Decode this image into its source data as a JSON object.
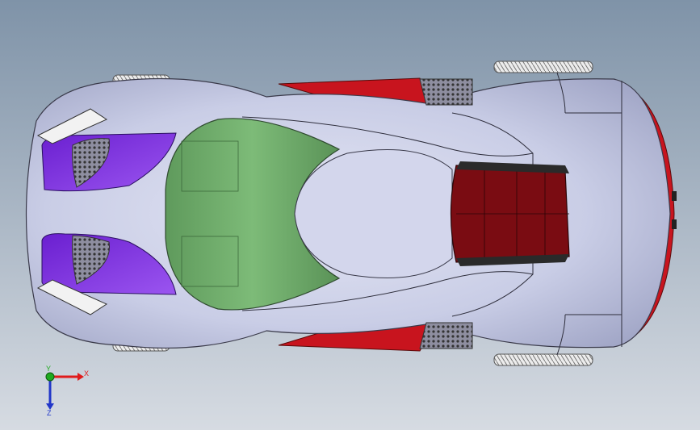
{
  "viewport": {
    "background_top": "#7f93a8",
    "background_bottom": "#d6dbe2"
  },
  "model": {
    "body_color": "#c9cde6",
    "body_shadow": "#9ea3c4",
    "canopy_color": "#73b06e",
    "headlight_color": "#7a2ee0",
    "accent_red": "#c8141e",
    "engine_cover_color": "#7a0c12",
    "tire_color": "#e6e6e6"
  },
  "triad": {
    "x_label": "X",
    "y_label": "Y",
    "z_label": "Z",
    "x_color": "#e01b1b",
    "y_color": "#1faa1f",
    "z_color": "#2136c9"
  }
}
